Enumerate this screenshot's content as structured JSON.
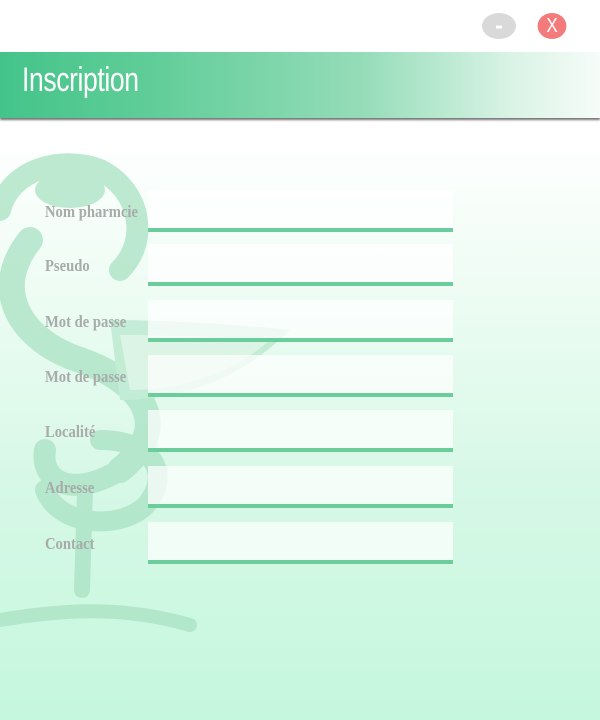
{
  "window_controls": {
    "minimize_label": "-",
    "close_label": "X"
  },
  "header": {
    "title": "Inscription"
  },
  "watermark": {
    "icon": "bowl-of-hygieia-icon"
  },
  "form": {
    "fields": [
      {
        "label": "Nom pharmcie",
        "value": ""
      },
      {
        "label": "Pseudo",
        "value": ""
      },
      {
        "label": "Mot de passe",
        "value": ""
      },
      {
        "label": "Mot de passe",
        "value": ""
      },
      {
        "label": "Localité",
        "value": ""
      },
      {
        "label": "Adresse",
        "value": ""
      },
      {
        "label": "Contact",
        "value": ""
      }
    ]
  },
  "colors": {
    "accent": "#44c48a",
    "underline": "#6ccd9c",
    "close": "#f47b7b",
    "minimize": "#d9d9d9",
    "label": "#a7aba9"
  }
}
